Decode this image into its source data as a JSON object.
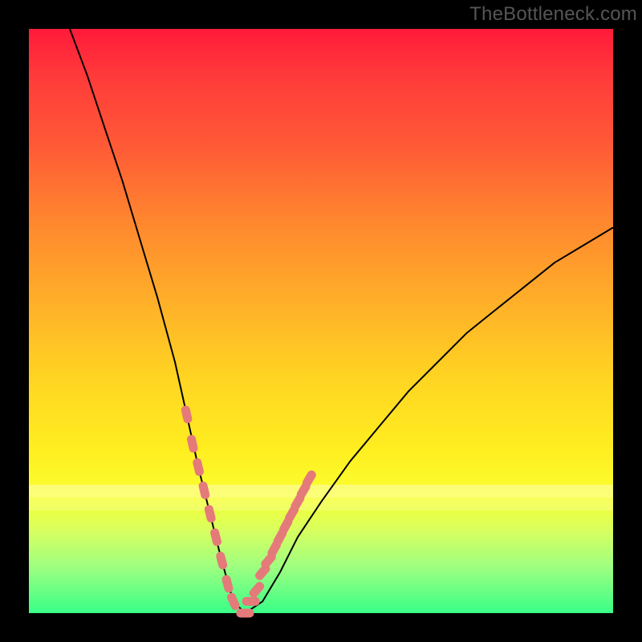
{
  "watermark": "TheBottleneck.com",
  "colors": {
    "gradient_top": "#ff1a3a",
    "gradient_mid": "#ffd522",
    "gradient_bottom": "#39ff88",
    "frame": "#000000",
    "curve": "#000000",
    "markers": "#e57a7a"
  },
  "chart_data": {
    "type": "line",
    "title": "",
    "xlabel": "",
    "ylabel": "",
    "xlim": [
      0,
      100
    ],
    "ylim": [
      0,
      100
    ],
    "grid": false,
    "legend": false,
    "note": "V-shaped bottleneck curve on red-to-green gradient; lower values are better (green). Minimum near x≈35 at y≈0.",
    "series": [
      {
        "name": "bottleneck-curve",
        "x": [
          7,
          10,
          13,
          16,
          19,
          22,
          25,
          27,
          29,
          31,
          33,
          35,
          37,
          40,
          43,
          46,
          50,
          55,
          60,
          65,
          70,
          75,
          80,
          85,
          90,
          95,
          100
        ],
        "y": [
          100,
          92,
          83,
          74,
          64,
          54,
          43,
          34,
          25,
          17,
          9,
          2,
          0,
          2,
          7,
          13,
          19,
          26,
          32,
          38,
          43,
          48,
          52,
          56,
          60,
          63,
          66
        ]
      }
    ],
    "markers": {
      "name": "highlighted-segments",
      "description": "pink lozenge markers along the curve near the minimum",
      "x": [
        27,
        28,
        29,
        30,
        31,
        32,
        33,
        34,
        35,
        37,
        38,
        39,
        40,
        41,
        42,
        43,
        44,
        45,
        46,
        47,
        48
      ],
      "y": [
        34,
        29,
        25,
        21,
        17,
        13,
        9,
        5,
        2,
        0,
        2,
        4,
        7,
        9,
        11,
        13,
        15,
        17,
        19,
        21,
        23
      ]
    }
  }
}
